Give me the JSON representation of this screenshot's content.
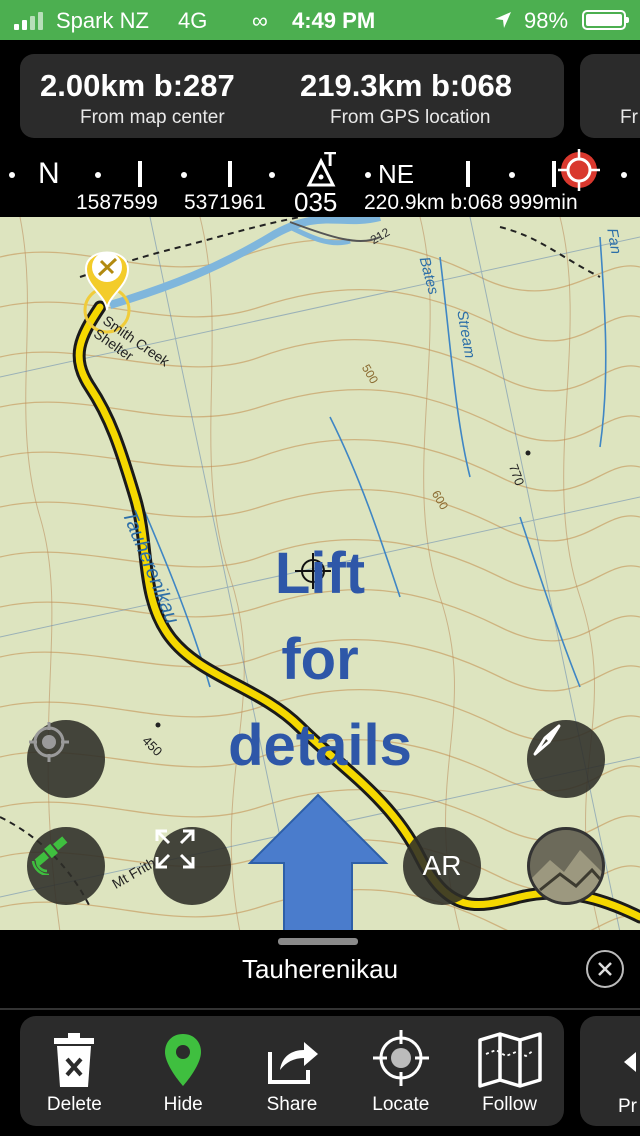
{
  "status_bar": {
    "carrier": "Spark NZ",
    "network": "4G",
    "time": "4:49 PM",
    "battery": "98%"
  },
  "info": {
    "map_center_value": "2.00km b:287",
    "map_center_label": "From map center",
    "gps_value": "219.3km b:068",
    "gps_label": "From GPS location",
    "side_label": "Fr"
  },
  "compass": {
    "left_marks": "• N • | • | • |",
    "north_label": "N",
    "true_marker": "T",
    "ne_label": "NE",
    "right_marks": "• | • |",
    "easting": "1587599",
    "northing": "5371961",
    "heading": "035",
    "target_info": "220.9km b:068 999min"
  },
  "map": {
    "label_shelter": "Smith Creek Shelter",
    "label_river": "Tauherenikau",
    "label_stream": "Stream",
    "label_bates": "Bates",
    "label_fan": "Fan",
    "label_mt_frith": "Mt Frith",
    "height_770": "770",
    "height_450": "450",
    "height_500": "500",
    "height_600": "600",
    "height_212": "212",
    "overlay_line1": "Lift",
    "overlay_line2": "for",
    "overlay_line3": "details",
    "ar_label": "AR"
  },
  "sheet": {
    "title": "Tauherenikau"
  },
  "toolbar": {
    "delete": "Delete",
    "hide": "Hide",
    "share": "Share",
    "locate": "Locate",
    "follow": "Follow",
    "more": "Pr"
  },
  "colors": {
    "status_green": "#4caf50",
    "track_yellow": "#f5d800",
    "overlay_blue": "#2e57a8",
    "arrow_blue": "#4a7ccc",
    "pin_green": "#3fbf3f"
  }
}
